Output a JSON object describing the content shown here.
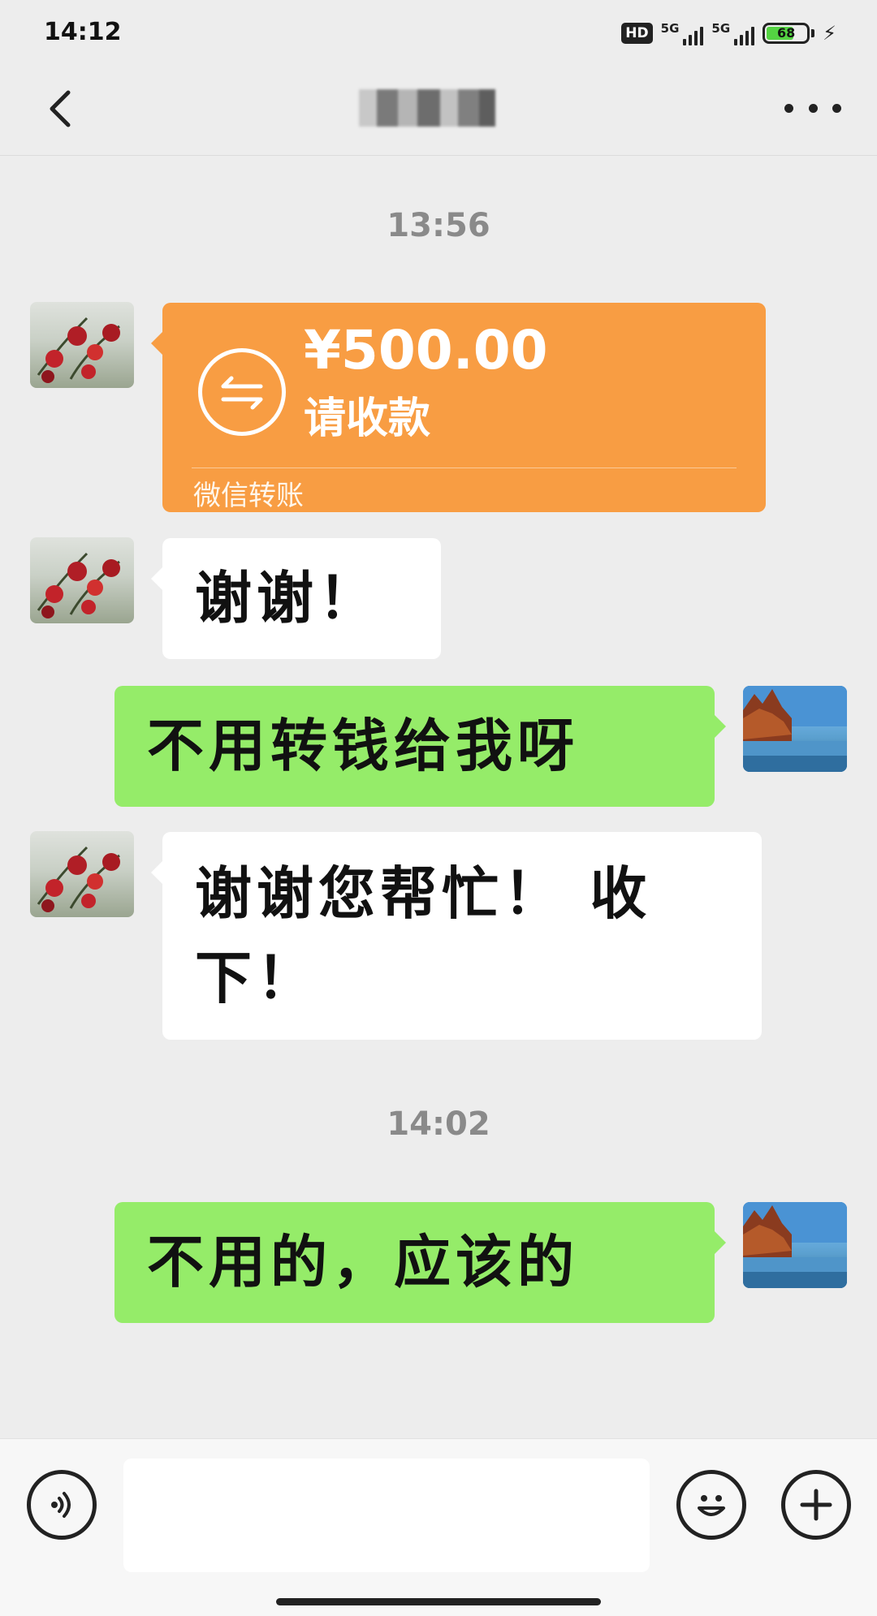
{
  "status_bar": {
    "time": "14:12",
    "hd_label": "HD",
    "network_1": "5G",
    "network_2": "5G",
    "battery_percent": "68",
    "charging": true
  },
  "header": {
    "back_icon": "chevron-left-icon",
    "title": "",
    "title_obscured": true,
    "more_icon": "more-dots-icon"
  },
  "messages": [
    {
      "type": "timestamp",
      "text": "13:56"
    },
    {
      "type": "transfer",
      "sender": "other",
      "amount": "¥500.00",
      "caption": "请收款",
      "brand": "微信转账",
      "color": "#f89d43"
    },
    {
      "type": "text",
      "sender": "other",
      "text": "谢谢！"
    },
    {
      "type": "text",
      "sender": "me",
      "text": "不用转钱给我呀"
    },
    {
      "type": "text",
      "sender": "other",
      "text": "谢谢您帮忙！ 收下！"
    },
    {
      "type": "timestamp",
      "text": "14:02"
    },
    {
      "type": "text",
      "sender": "me",
      "text": "不用的，应该的"
    }
  ],
  "input_bar": {
    "voice_icon": "voice-icon",
    "input_value": "",
    "emoji_icon": "emoji-icon",
    "plus_icon": "plus-icon"
  },
  "colors": {
    "background": "#ededed",
    "bubble_me": "#95ec69",
    "bubble_other": "#ffffff",
    "transfer": "#f89d43"
  }
}
